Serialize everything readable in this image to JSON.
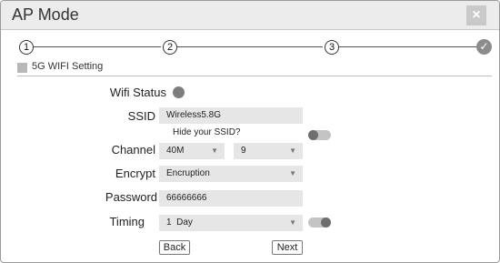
{
  "window": {
    "title": "AP Mode",
    "close_glyph": "×"
  },
  "stepper": {
    "steps": [
      "1",
      "2",
      "3"
    ],
    "done_glyph": "✓"
  },
  "section": {
    "label": "5G WIFI Setting"
  },
  "form": {
    "wifi_status_label": "Wifi Status",
    "ssid_label": "SSID",
    "ssid_value": "Wireless5.8G",
    "hide_ssid_label": "Hide your SSID?",
    "channel_label": "Channel",
    "channel_width": "40M",
    "channel_number": "9",
    "encrypt_label": "Encrypt",
    "encrypt_value": "Encruption",
    "password_label": "Password",
    "password_value": "66666666",
    "timing_label": "Timing",
    "timing_value": "1  Day"
  },
  "buttons": {
    "back": "Back",
    "next": "Next"
  }
}
